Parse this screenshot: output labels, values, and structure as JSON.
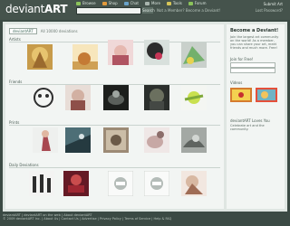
{
  "brand": {
    "logo_main": "deviant",
    "logo_rest": "ART"
  },
  "nav": {
    "items": [
      {
        "label": "Browse",
        "color": "#8bc35a"
      },
      {
        "label": "Shop",
        "color": "#e29a3c"
      },
      {
        "label": "Chat",
        "color": "#6aa3c9"
      },
      {
        "label": "More",
        "color": "#a8b4ad"
      },
      {
        "label": "Tools",
        "color": "#d6c558"
      },
      {
        "label": "Forum",
        "color": "#8bc35a"
      }
    ],
    "search_button": "Search",
    "tagline": "Not a Member? Become a Deviant!",
    "login": "Lost Password?",
    "submit": "Submit Art"
  },
  "main": {
    "tab_label": "deviantART",
    "tab_text": "All 10000 deviations",
    "sections": [
      {
        "title": "Artists"
      },
      {
        "title": "Friends"
      },
      {
        "title": "Prints"
      },
      {
        "title": "Daily Deviations"
      }
    ]
  },
  "sidebar": {
    "title": "Become a Deviant!",
    "text": "Join the largest art community on the world! As a member, you can share your art, meet friends and much more. Free!",
    "field_label": "Join for Free!",
    "section_label": "Videos",
    "promo_title": "deviantART Loves You",
    "promo_text": "Celebrate art and the community."
  },
  "footer": {
    "line1": "deviantART  |  deviantART on the web  |  About deviantART",
    "line2": "© 2009 deviantART Inc.  |  About Us  |  Contact Us  |  Advertise  |  Privacy Policy  |  Terms of Service  |  Help & FAQ"
  }
}
